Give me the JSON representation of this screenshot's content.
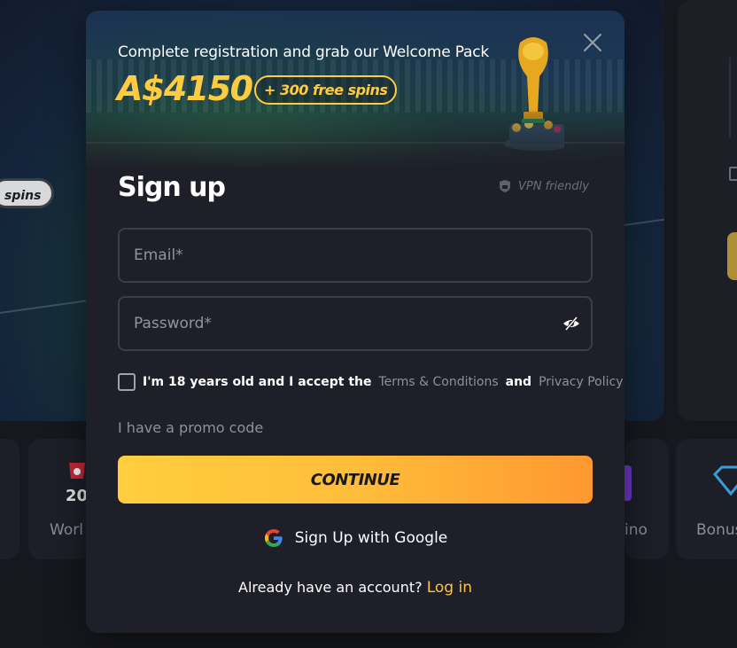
{
  "background": {
    "pill_text": "spins",
    "cards": [
      {
        "label": "Worl"
      },
      {
        "label": "ino"
      },
      {
        "label": "Bonus"
      }
    ]
  },
  "modal": {
    "hero": {
      "subtitle": "Complete registration and grab our Welcome Pack",
      "amount": "A$4150",
      "badge": "+ 300 free spins"
    },
    "close_icon": "close-icon",
    "title": "Sign up",
    "vpn_label": "VPN friendly",
    "email": {
      "placeholder": "Email*",
      "value": ""
    },
    "password": {
      "placeholder": "Password*",
      "value": ""
    },
    "terms": {
      "prefix": "I'm 18 years old and I accept the",
      "terms_link": "Terms & Conditions",
      "and": "and",
      "privacy_link": "Privacy Policy"
    },
    "promo_label": "I have a promo code",
    "continue_label": "CONTINUE",
    "google_label": "Sign Up with Google",
    "login_prompt": "Already have an account?",
    "login_link": "Log in"
  },
  "colors": {
    "accent": "#ffcb40",
    "button_start": "#ffce3e",
    "button_end": "#ff9830",
    "modal_bg": "#1e1f28"
  }
}
